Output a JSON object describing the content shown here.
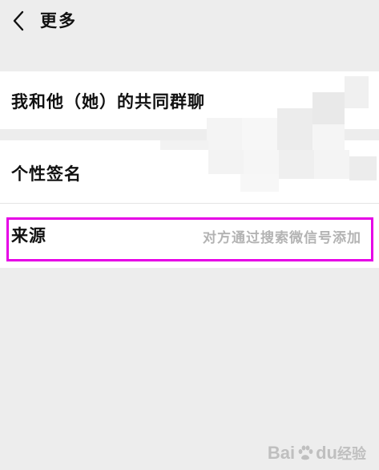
{
  "header": {
    "title": "更多",
    "back_icon": "chevron-left-icon"
  },
  "rows": {
    "groups": {
      "label": "我和他（她）的共同群聊"
    },
    "signature": {
      "label": "个性签名"
    },
    "source": {
      "label": "来源",
      "value": "对方通过搜索微信号添加"
    }
  },
  "colors": {
    "background": "#ededed",
    "row_background": "#ffffff",
    "text": "#111111",
    "value_text": "#b3b3b3",
    "highlight": "#e600e6"
  },
  "watermark": {
    "latin": "Bai",
    "suffix": "du",
    "cn": "经验"
  }
}
